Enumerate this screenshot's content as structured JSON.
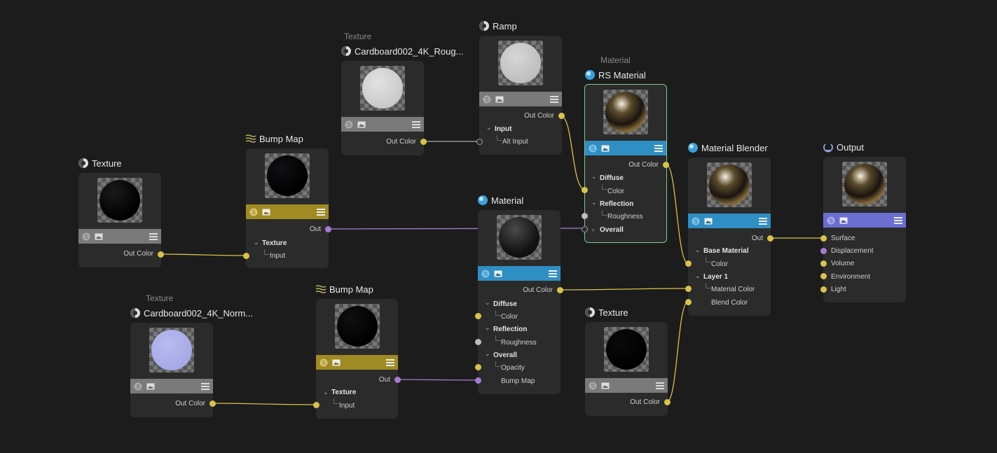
{
  "colors": {
    "background": "#1c1c1c",
    "node_body": "#2b2b2b",
    "bar_gray": "#7a7a7a",
    "bar_gold": "#a08a23",
    "bar_blue": "#2f8fc4",
    "bar_purple": "#6b6ed0",
    "selected_border": "#7fc98a",
    "wire_yellow": "#d9c24a",
    "wire_purple": "#9f7fd0",
    "wire_gray": "#aaaaaa"
  },
  "nodes": {
    "tex_left": {
      "title": "Texture",
      "icon": "texture-icon",
      "out_label": "Out Color"
    },
    "bump_top": {
      "title": "Bump Map",
      "icon": "bump-map-icon",
      "out_label": "Out",
      "group_label": "Texture",
      "input_label": "Input"
    },
    "tex_rough": {
      "subtitle": "Texture",
      "title": "Cardboard002_4K_Roug...",
      "icon": "texture-icon",
      "out_label": "Out Color"
    },
    "ramp": {
      "title": "Ramp",
      "icon": "ramp-icon",
      "out_label": "Out Color",
      "group_label": "Input",
      "input_label": "Alt Input"
    },
    "rs_material": {
      "subtitle": "Material",
      "title": "RS Material",
      "icon": "material-sphere-icon",
      "out_label": "Out Color",
      "diffuse": "Diffuse",
      "color": "Color",
      "reflection": "Reflection",
      "roughness": "Roughness",
      "overall": "Overall"
    },
    "material": {
      "title": "Material",
      "icon": "material-sphere-icon",
      "out_label": "Out Color",
      "diffuse": "Diffuse",
      "color": "Color",
      "reflection": "Reflection",
      "roughness": "Roughness",
      "overall": "Overall",
      "opacity": "Opacity",
      "bump_map": "Bump Map"
    },
    "blender": {
      "title": "Material Blender",
      "icon": "material-sphere-icon",
      "out_label": "Out",
      "base_material": "Base Material",
      "color": "Color",
      "layer1": "Layer 1",
      "material_color": "Material Color",
      "blend_color": "Blend Color"
    },
    "output": {
      "title": "Output",
      "icon": "output-icon",
      "surface": "Surface",
      "displacement": "Displacement",
      "volume": "Volume",
      "environment": "Environment",
      "light": "Light"
    },
    "tex_normal": {
      "subtitle": "Texture",
      "title": "Cardboard002_4K_Norm...",
      "icon": "texture-icon",
      "out_label": "Out Color"
    },
    "bump_bottom": {
      "title": "Bump Map",
      "icon": "bump-map-icon",
      "out_label": "Out",
      "group_label": "Texture",
      "input_label": "Input"
    },
    "tex_right": {
      "title": "Texture",
      "icon": "texture-icon",
      "out_label": "Out Color"
    }
  }
}
